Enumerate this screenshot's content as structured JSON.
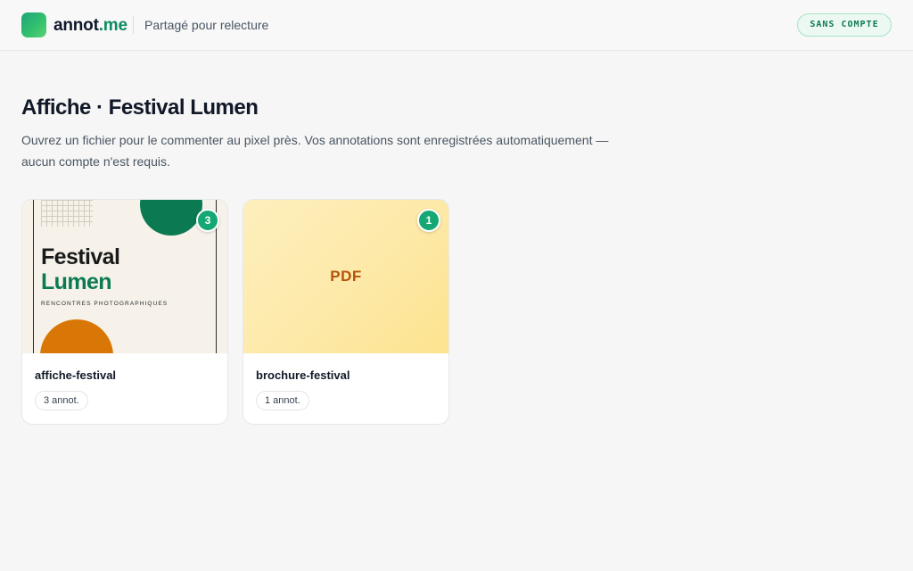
{
  "header": {
    "brand_main": "annot",
    "brand_accent": ".me",
    "subtitle": "Partagé pour relecture",
    "account_badge": "SANS COMPTE"
  },
  "page": {
    "title": "Affiche · Festival Lumen",
    "description": "Ouvrez un fichier pour le commenter au pixel près. Vos annotations sont enregistrées automatiquement — aucun compte n'est requis."
  },
  "files": [
    {
      "name": "affiche-festival",
      "annotation_count": "3",
      "annotation_chip": "3 annot.",
      "thumbnail": {
        "kind": "poster",
        "line1": "Festival",
        "line2": "Lumen",
        "tagline": "RENCONTRES PHOTOGRAPHIQUES"
      }
    },
    {
      "name": "brochure-festival",
      "annotation_count": "1",
      "annotation_chip": "1 annot.",
      "thumbnail": {
        "kind": "pdf",
        "label": "PDF"
      }
    }
  ],
  "colors": {
    "brand": "#0f8a5f",
    "badge_bubble": "#15a874",
    "pdf_label": "#b45309",
    "poster_green": "#0b7a52",
    "poster_orange": "#d97706"
  },
  "icons": {
    "logo": "annot-logo-icon"
  }
}
